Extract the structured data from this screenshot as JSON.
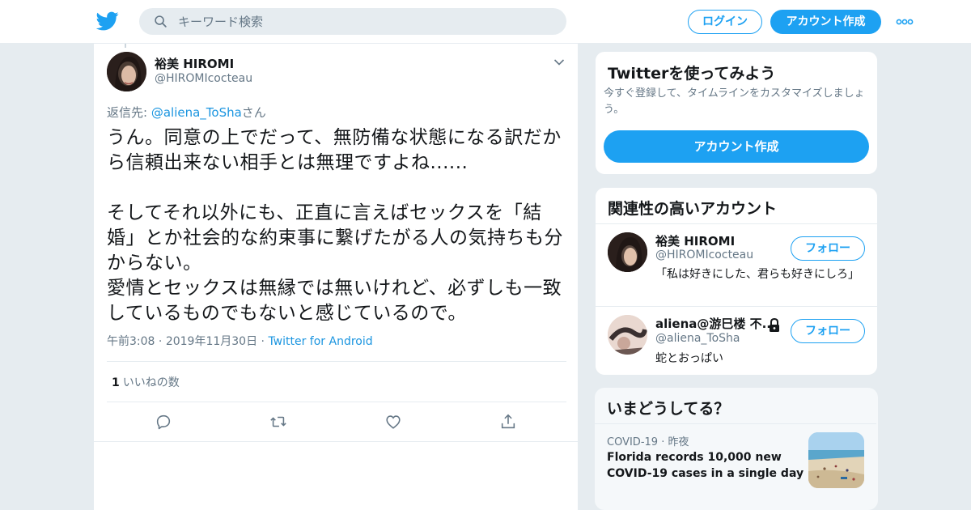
{
  "nav": {
    "search_placeholder": "キーワード検索",
    "login": "ログイン",
    "signup": "アカウント作成",
    "brand_color": "#1da1f2"
  },
  "tweet": {
    "author_name": "裕美 HIROMI",
    "author_handle": "@HIROMIcocteau",
    "reply_prefix": "返信先: ",
    "reply_handle": "@aliena_ToSha",
    "reply_suffix": "さん",
    "text": "うん。同意の上でだって、無防備な状態になる訳だから信頼出来ない相手とは無理ですよね......\n\nそしてそれ以外にも、正直に言えばセックスを「結婚」とか社会的な約束事に繋げたがる人の気持ちも分からない。\n愛情とセックスは無縁では無いけれど、必ずしも一致しているものでもないと感じているので。",
    "time": "午前3:08",
    "date": "2019年11月30日",
    "source": "Twitter for Android",
    "like_count": "1",
    "like_label": "いいねの数",
    "actions": [
      "reply-icon",
      "retweet-icon",
      "like-icon",
      "share-icon"
    ]
  },
  "try_twitter": {
    "title": "Twitterを使ってみよう",
    "desc": "今すぐ登録して、タイムラインをカスタマイズしましょう。",
    "button": "アカウント作成"
  },
  "related": {
    "title": "関連性の高いアカウント",
    "accounts": [
      {
        "name": "裕美 HIROMI",
        "handle": "@HIROMIcocteau",
        "bio": "「私は好きにした、君らも好きにしろ」",
        "follow": "フォロー",
        "protected": false
      },
      {
        "name": "aliena@游巳楼 不...",
        "handle": "@aliena_ToSha",
        "bio": "蛇とおっぱい",
        "follow": "フォロー",
        "protected": true
      }
    ]
  },
  "trends": {
    "title": "いまどうしてる？",
    "items": [
      {
        "category": "COVID-19",
        "time": "昨夜",
        "text": "Florida records 10,000 new COVID-19 cases in a single day"
      }
    ]
  }
}
